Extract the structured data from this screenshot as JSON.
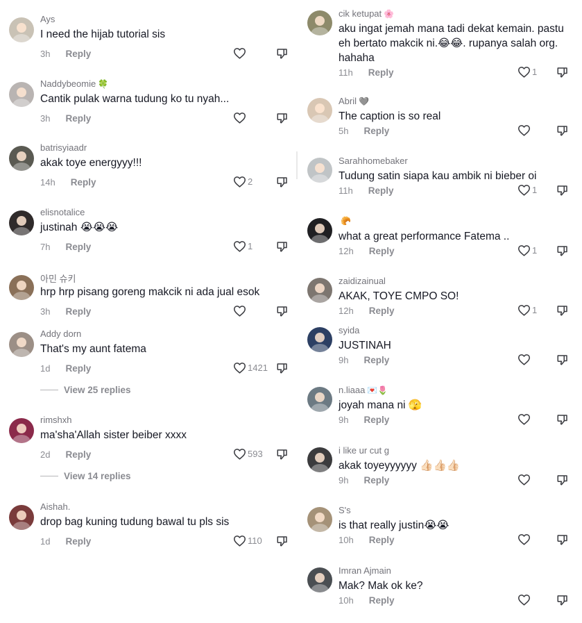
{
  "left": [
    {
      "user": "Ays",
      "badge": "",
      "text": "I need the hijab tutorial sis",
      "time": "3h",
      "likes": "",
      "replies": "",
      "avatar_color": "#c9c2b5"
    },
    {
      "user": "Naddybeomie",
      "badge": "🍀",
      "text": "Cantik pulak warna tudung ko tu nyah...",
      "time": "3h",
      "likes": "",
      "replies": "",
      "avatar_color": "#b9b4b2"
    },
    {
      "user": "batrisyiaadr",
      "badge": "",
      "text": "akak toye energyyy!!!",
      "time": "14h",
      "likes": "2",
      "replies": "",
      "avatar_color": "#5a5a52"
    },
    {
      "user": "elisnotalice",
      "badge": "",
      "text": "justinah 😭😭😭",
      "time": "7h",
      "likes": "1",
      "replies": "",
      "avatar_color": "#2f2a2a"
    },
    {
      "user": "아민 슈키",
      "badge": "",
      "text": "hrp hrp pisang goreng makcik ni ada jual esok",
      "time": "3h",
      "likes": "",
      "replies": "",
      "avatar_color": "#8a7058"
    },
    {
      "user": "Addy dorn",
      "badge": "",
      "text": "That's my aunt fatema",
      "time": "1d",
      "likes": "1421",
      "replies": "View 25 replies",
      "avatar_color": "#9c8f86"
    },
    {
      "user": "rimshxh",
      "badge": "",
      "text": "ma'sha'Allah sister beiber xxxx",
      "time": "2d",
      "likes": "593",
      "replies": "View 14 replies",
      "avatar_color": "#8b2a4a"
    },
    {
      "user": "Aishah.",
      "badge": "",
      "text": "drop bag kuning tudung bawal tu pls sis",
      "time": "1d",
      "likes": "110",
      "replies": "",
      "avatar_color": "#7a3b3b"
    }
  ],
  "right": [
    {
      "user": "cik ketupat",
      "badge": "🌸",
      "text": "aku ingat jemah mana tadi dekat kemain. pastu\neh bertato makcik ni.😂😂. rupanya salah org.\nhahaha",
      "time": "11h",
      "likes": "1",
      "avatar_color": "#8d8a6a"
    },
    {
      "user": "Abril",
      "badge": "🩶",
      "text": "The caption is so real",
      "time": "5h",
      "likes": "",
      "avatar_color": "#d9c7b4"
    },
    {
      "user": "Sarahhomebaker",
      "badge": "",
      "text": "Tudung satin siapa kau ambik ni bieber oi",
      "time": "11h",
      "likes": "1",
      "avatar_color": "#c0c4c6"
    },
    {
      "user": "",
      "badge": "🥐",
      "text": "what a great performance Fatema ..",
      "time": "12h",
      "likes": "1",
      "avatar_color": "#1f1f22"
    },
    {
      "user": "zaidizainual",
      "badge": "",
      "text": "AKAK, TOYE CMPO SO!",
      "time": "12h",
      "likes": "1",
      "avatar_color": "#7d7670"
    },
    {
      "user": "syida",
      "badge": "",
      "text": "JUSTINAH",
      "time": "9h",
      "likes": "",
      "avatar_color": "#2c3f63"
    },
    {
      "user": "n.liaaa",
      "badge": "💌🌷",
      "text": "joyah mana ni 🫣",
      "time": "9h",
      "likes": "",
      "avatar_color": "#6c7a83"
    },
    {
      "user": "i like ur cut g",
      "badge": "",
      "text": "akak toyeyyyyyy 👍🏻👍🏻👍🏻",
      "time": "9h",
      "likes": "",
      "avatar_color": "#3b3b3d"
    },
    {
      "user": "S's",
      "badge": "",
      "text": "is that really justin😭😭",
      "time": "10h",
      "likes": "",
      "avatar_color": "#a59278"
    },
    {
      "user": "Imran Ajmain",
      "badge": "",
      "text": "Mak? Mak ok ke?",
      "time": "10h",
      "likes": "",
      "avatar_color": "#4a4e52"
    }
  ],
  "reply_label": "Reply",
  "icons": {
    "like": "heart-outline-icon",
    "dislike": "thumbs-down-outline-icon"
  }
}
